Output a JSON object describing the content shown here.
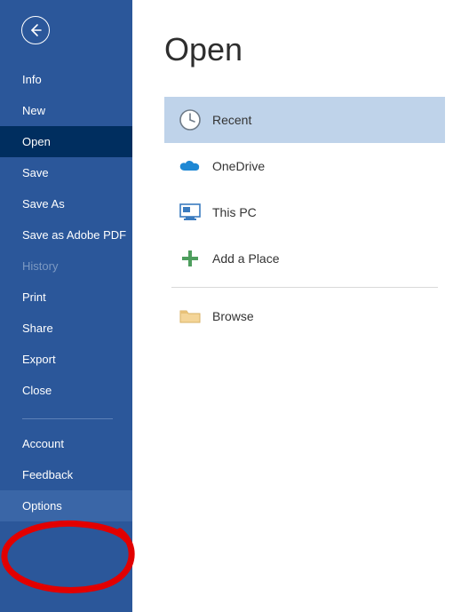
{
  "sidebar": {
    "items": [
      {
        "label": "Info"
      },
      {
        "label": "New"
      },
      {
        "label": "Open"
      },
      {
        "label": "Save"
      },
      {
        "label": "Save As"
      },
      {
        "label": "Save as Adobe PDF"
      },
      {
        "label": "History"
      },
      {
        "label": "Print"
      },
      {
        "label": "Share"
      },
      {
        "label": "Export"
      },
      {
        "label": "Close"
      },
      {
        "label": "Account"
      },
      {
        "label": "Feedback"
      },
      {
        "label": "Options"
      }
    ]
  },
  "main": {
    "title": "Open",
    "locations": [
      {
        "label": "Recent"
      },
      {
        "label": "OneDrive"
      },
      {
        "label": "This PC"
      },
      {
        "label": "Add a Place"
      },
      {
        "label": "Browse"
      }
    ]
  }
}
